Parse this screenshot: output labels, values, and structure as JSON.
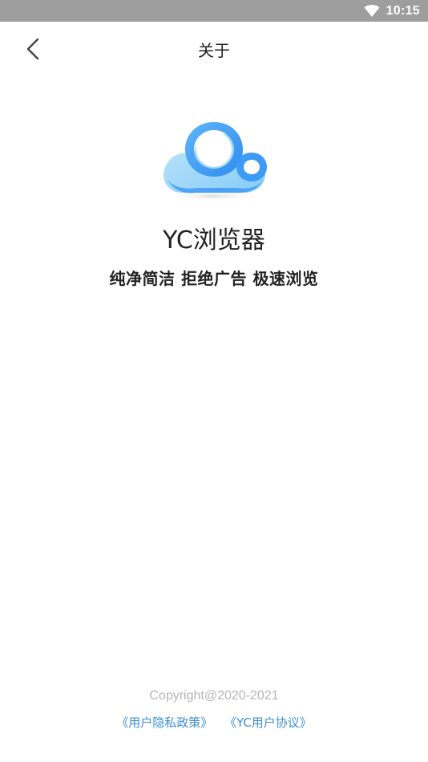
{
  "status_bar": {
    "time": "10:15",
    "icons": [
      "wifi-icon"
    ]
  },
  "header": {
    "title": "关于",
    "back_icon": "chevron-left-icon"
  },
  "app": {
    "logo_icon": "cloud-logo-icon",
    "name": "YC浏览器",
    "slogan": "纯净简洁 拒绝广告 极速浏览"
  },
  "footer": {
    "copyright": "Copyright@2020-2021",
    "privacy_link": "《用户隐私政策》",
    "agreement_link": "《YC用户协议》"
  },
  "colors": {
    "status_bar_bg": "#9e9e9e",
    "link": "#3c8fd6",
    "copyright": "#b5b5b5",
    "logo_blue": "#3d9bf5",
    "logo_light_blue": "#a9dcfb"
  }
}
